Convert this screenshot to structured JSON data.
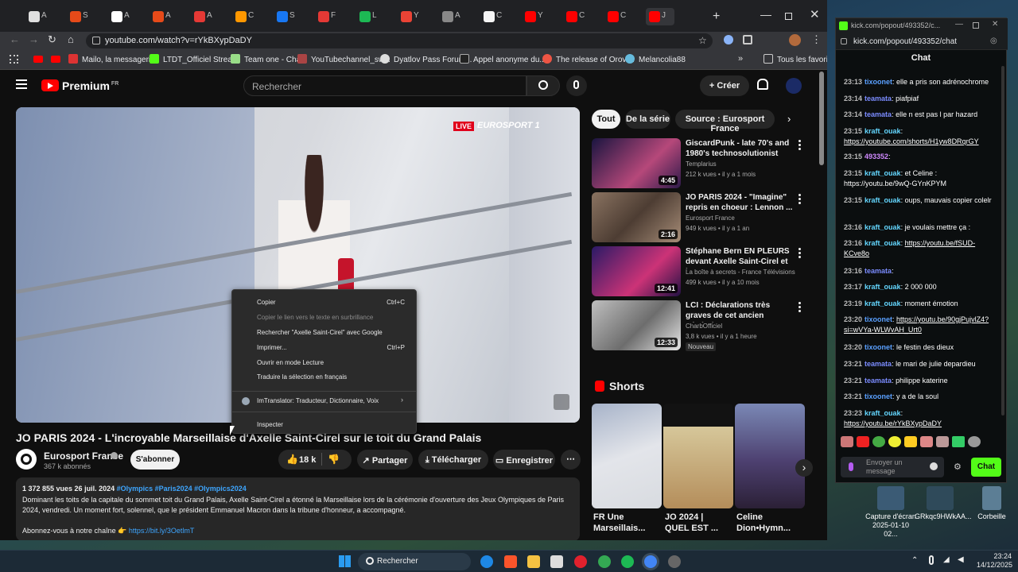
{
  "browser": {
    "url": "youtube.com/watch?v=rYkBXypDaDY",
    "tabs": [
      "A",
      "S",
      "A",
      "A",
      "A",
      "C",
      "S",
      "F",
      "L",
      "Y",
      "A",
      "C",
      "Y",
      "C",
      "C",
      "J"
    ],
    "bookmarks": [
      "Mailo, la messageri...",
      "LTDT_Officiel Strea...",
      "Team one - Chat",
      "YouTubechannel_sw...",
      "Dyatlov Pass Forum...",
      "Appel anonyme du...",
      "The release of Orovi...",
      "Melancolia88",
      "Tous les favoris"
    ]
  },
  "youtube": {
    "logo": "Premium",
    "logo_country": "FR",
    "search_placeholder": "Rechercher",
    "create_label": "Créer",
    "chips": [
      "Tout",
      "De la série",
      "Source : Eurosport France"
    ],
    "player": {
      "live_badge": "LIVE",
      "broadcaster": "EUROSPORT 1"
    },
    "video": {
      "title": "JO PARIS 2024 - L'incroyable Marseillaise d'Axelle Saint-Cirel sur le toit du Grand Palais",
      "channel": "Eurosport France",
      "subscribers": "367 k abonnés",
      "subscribe_label": "S'abonner",
      "likes": "18 k",
      "share_label": "Partager",
      "download_label": "Télécharger",
      "save_label": "Enregistrer",
      "views_date": "1 372 855 vues  26 juil. 2024",
      "hashtags": "#Olympics #Paris2024 #Olympics2024",
      "description": "Dominant les toits de la capitale du sommet toit du Grand Palais, Axelle Saint-Cirel a étonné la Marseillaise lors de la cérémonie d'ouverture des Jeux Olympiques de Paris 2024, vendredi. Un moment fort, solennel, que le président Emmanuel Macron dans la tribune d'honneur, a accompagné.",
      "subscribe_line": "Abonnez-vous à notre chaîne 👉",
      "subscribe_link": "https://bit.ly/3OetlmT"
    },
    "context_menu": {
      "items": [
        {
          "label": "Copier",
          "shortcut": "Ctrl+C",
          "disabled": false
        },
        {
          "label": "Copier le lien vers le texte en surbrillance",
          "shortcut": "",
          "disabled": true
        },
        {
          "label": "Rechercher \"Axelle Saint-Cirel\" avec Google",
          "shortcut": "",
          "disabled": false
        },
        {
          "label": "Imprimer...",
          "shortcut": "Ctrl+P",
          "disabled": false
        },
        {
          "label": "Ouvrir en mode Lecture",
          "shortcut": "",
          "disabled": false
        },
        {
          "label": "Traduire la sélection en français",
          "shortcut": "",
          "disabled": false
        },
        {
          "label": "ImTranslator: Traducteur, Dictionnaire, Voix",
          "shortcut": "",
          "disabled": false
        },
        {
          "label": "Inspecter",
          "shortcut": "",
          "disabled": false
        }
      ]
    },
    "related": [
      {
        "title": "GiscardPunk - late 70's and 1980's technosolutionist Franc...",
        "channel": "Templarius",
        "meta": "212 k vues • il y a 1 mois",
        "duration": "4:45",
        "badge": ""
      },
      {
        "title": "JO PARIS 2024 - \"Imagine\" repris en choeur : Lennon ...",
        "channel": "Eurosport France",
        "meta": "949 k vues • il y a 1 an",
        "duration": "2:16",
        "badge": ""
      },
      {
        "title": "Stéphane Bern EN PLEURS devant Axelle Saint-Cirel et les...",
        "channel": "La boîte à secrets - France Télévisions",
        "meta": "499 k vues • il y a 10 mois",
        "duration": "12:41",
        "badge": ""
      },
      {
        "title": "LCI : Déclarations très graves de cet ancien général ! ...",
        "channel": "CharbOfficiel",
        "meta": "3,8 k vues • il y a 1 heure",
        "duration": "12:33",
        "badge": "Nouveau"
      }
    ],
    "shorts_heading": "Shorts",
    "shorts": [
      {
        "title": "FR Une Marseillais..."
      },
      {
        "title": "JO 2024 | QUEL EST ..."
      },
      {
        "title": "Celine Dion•Hymn..."
      }
    ]
  },
  "kick": {
    "url": "kick.com/popout/493352/chat",
    "window_title": "kick.com/popout/493352/c...",
    "header": "Chat",
    "messages": [
      {
        "time": "23:13",
        "user": "tixoonet",
        "color": "#5aa0ff",
        "text": "elle a pris son adrénochrome"
      },
      {
        "time": "23:14",
        "user": "teamata",
        "color": "#7b8cff",
        "text": "piafpiaf"
      },
      {
        "time": "23:14",
        "user": "teamata",
        "color": "#7b8cff",
        "text": "elle n est pas l par hazard"
      },
      {
        "time": "23:15",
        "user": "kraft_ouak",
        "color": "#64d7ff",
        "text": "https://youtube.com/shorts/H1yw8DRqrGY"
      },
      {
        "time": "23:15",
        "user": "493352",
        "color": "#d08aff",
        "text": ""
      },
      {
        "time": "23:15",
        "user": "kraft_ouak",
        "color": "#64d7ff",
        "text": "et Celine : https://youtu.be/9wQ-GYnKPYM"
      },
      {
        "time": "23:15",
        "user": "kraft_ouak",
        "color": "#64d7ff",
        "text": "oups, mauvais copier colelr"
      },
      {
        "time": "23:16",
        "user": "kraft_ouak",
        "color": "#64d7ff",
        "text": "je voulais mettre ça :"
      },
      {
        "time": "23:16",
        "user": "kraft_ouak",
        "color": "#64d7ff",
        "text": "https://youtu.be/fSUD-KCve8o"
      },
      {
        "time": "23:16",
        "user": "teamata",
        "color": "#7b8cff",
        "text": ""
      },
      {
        "time": "23:17",
        "user": "kraft_ouak",
        "color": "#64d7ff",
        "text": "2 000 000"
      },
      {
        "time": "23:19",
        "user": "kraft_ouak",
        "color": "#64d7ff",
        "text": "moment émotion"
      },
      {
        "time": "23:20",
        "user": "tixoonet",
        "color": "#5aa0ff",
        "text": "https://youtu.be/90gjPujvlZ4?si=wVYa-WLWvAH_Urt0"
      },
      {
        "time": "23:20",
        "user": "tixoonet",
        "color": "#5aa0ff",
        "text": "le festin des dieux"
      },
      {
        "time": "23:21",
        "user": "teamata",
        "color": "#7b8cff",
        "text": "le mari de julie depardieu"
      },
      {
        "time": "23:21",
        "user": "teamata",
        "color": "#7b8cff",
        "text": "philippe katerine"
      },
      {
        "time": "23:21",
        "user": "tixoonet",
        "color": "#5aa0ff",
        "text": "y a de la soul"
      },
      {
        "time": "23:23",
        "user": "kraft_ouak",
        "color": "#64d7ff",
        "text": "https://youtu.be/rYkBXypDaDY"
      }
    ],
    "input_placeholder": "Envoyer un message",
    "send_label": "Chat"
  },
  "desktop": {
    "icons": [
      {
        "label": "Capture d'écran 2025-01-10 02..."
      },
      {
        "label": "GRkqc9HWkAA..."
      },
      {
        "label": "Corbeille"
      }
    ]
  },
  "taskbar": {
    "search_label": "Rechercher",
    "time": "23:24",
    "date": "14/12/2025"
  }
}
